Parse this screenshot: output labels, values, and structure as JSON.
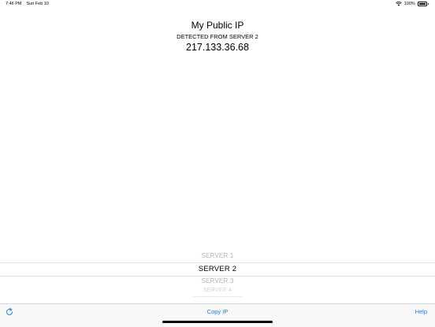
{
  "status_bar": {
    "time": "7:46 PM",
    "date": "Sun Feb 10",
    "battery": "100%",
    "battery_level": 1.0
  },
  "header": {
    "title": "My Public IP",
    "detected_from": "DETECTED FROM SERVER 2",
    "ip": "217.133.36.68"
  },
  "picker": {
    "options": [
      "SERVER 1",
      "SERVER 2",
      "SERVER 3",
      "SERVER 4"
    ],
    "selected": "SERVER 2"
  },
  "toolbar": {
    "refresh_icon": "refresh-icon",
    "copy_label": "Copy IP",
    "help_label": "Help"
  },
  "colors": {
    "accent": "#1a7cf5",
    "picker_inactive": "#b4b4b8"
  }
}
